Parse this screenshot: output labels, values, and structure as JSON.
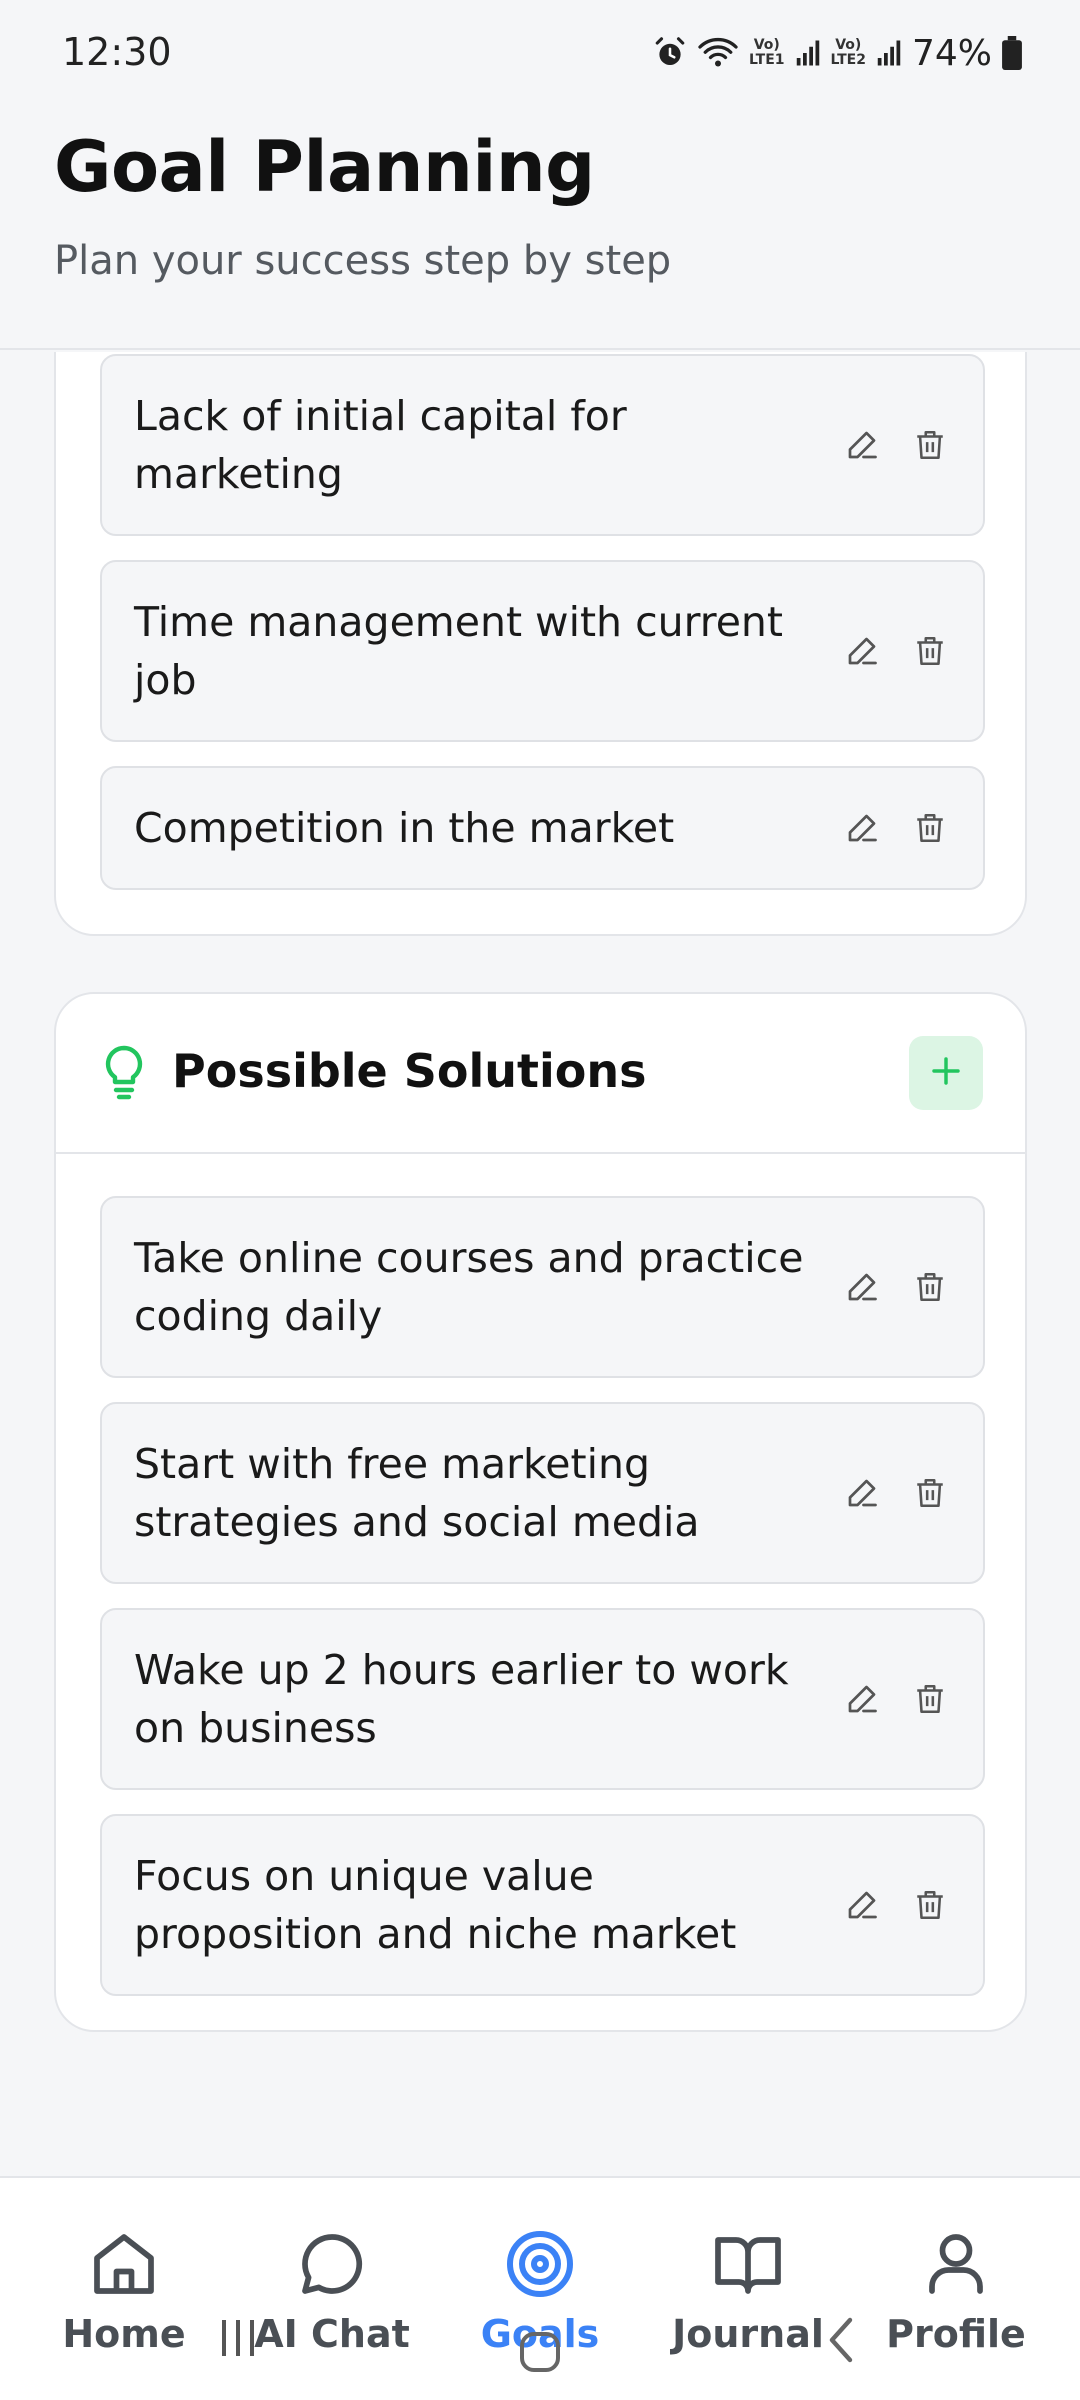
{
  "status_bar": {
    "time": "12:30",
    "battery": "74%",
    "sim1": "LTE1",
    "sim2": "LTE2",
    "icons": [
      "alarm-icon",
      "wifi-icon",
      "signal-icon",
      "signal-icon",
      "battery-icon"
    ]
  },
  "header": {
    "title": "Goal Planning",
    "subtitle": "Plan your success step by step"
  },
  "challenges": {
    "items": [
      "Lack of initial capital for marketing",
      "Time management with current job",
      "Competition in the market"
    ]
  },
  "solutions": {
    "title": "Possible Solutions",
    "icon": "lightbulb-icon",
    "items": [
      "Take online courses and practice coding daily",
      "Start with free marketing strategies and social media",
      "Wake up 2 hours earlier to work on business",
      "Focus on unique value proposition and niche market"
    ]
  },
  "bottom_nav": {
    "items": [
      {
        "label": "Home",
        "icon": "home-icon"
      },
      {
        "label": "AI Chat",
        "icon": "chat-icon"
      },
      {
        "label": "Goals",
        "icon": "target-icon",
        "active": true
      },
      {
        "label": "Journal",
        "icon": "book-icon"
      },
      {
        "label": "Profile",
        "icon": "user-icon"
      }
    ]
  },
  "colors": {
    "accent_blue": "#3b82f6",
    "accent_green": "#22c55e",
    "add_button_bg": "#dcf5e4",
    "background": "#f5f6f8"
  }
}
